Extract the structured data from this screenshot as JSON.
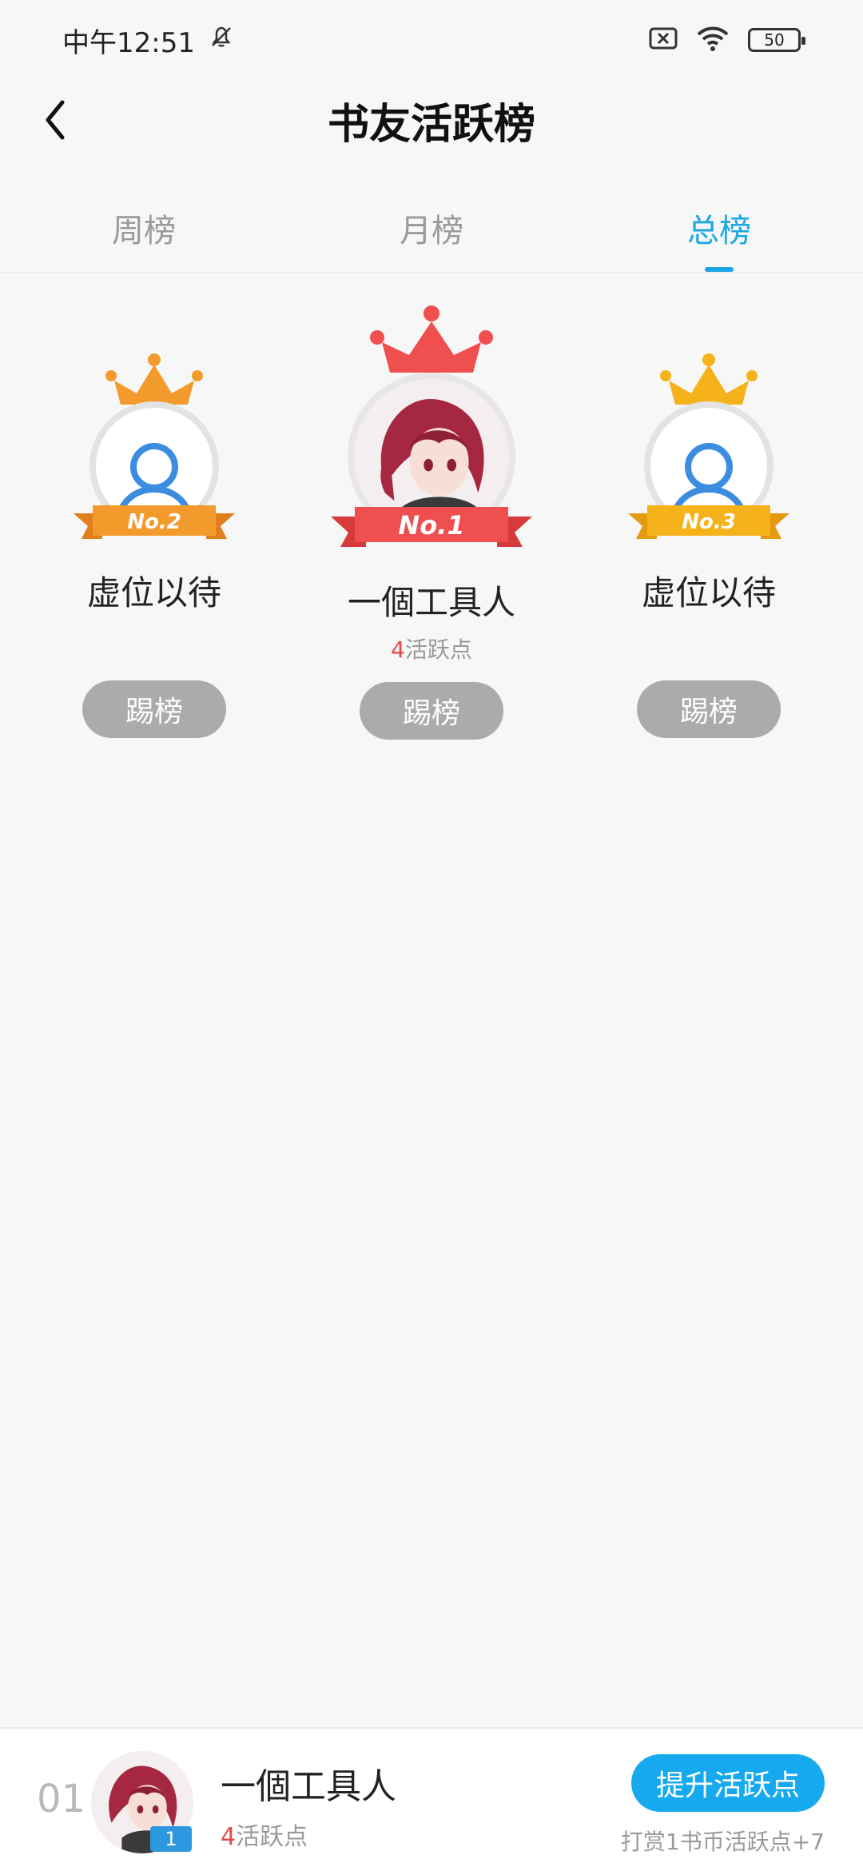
{
  "status_bar": {
    "time": "中午12:51",
    "battery": "50",
    "icons": [
      "mute-bell-icon",
      "sim-off-icon",
      "wifi-icon",
      "battery-icon"
    ]
  },
  "header": {
    "title": "书友活跃榜",
    "back_icon": "back-chevron-icon"
  },
  "tabs": [
    {
      "label": "周榜",
      "active": false
    },
    {
      "label": "月榜",
      "active": false
    },
    {
      "label": "总榜",
      "active": true
    }
  ],
  "podium": {
    "second": {
      "badge": "No.2",
      "name": "虚位以待",
      "button": "踢榜"
    },
    "first": {
      "badge": "No.1",
      "name": "一個工具人",
      "points": "4",
      "points_suffix": "活跃点",
      "button": "踢榜"
    },
    "third": {
      "badge": "No.3",
      "name": "虚位以待",
      "button": "踢榜"
    }
  },
  "bottom_bar": {
    "rank": "01",
    "level_badge": "1",
    "name": "一個工具人",
    "points": "4",
    "points_suffix": "活跃点",
    "promote_button": "提升活跃点",
    "tip": "打赏1书币活跃点+7"
  },
  "colors": {
    "accent": "#1aa7e4",
    "second_orange": "#f39a2d",
    "first_red": "#f04f4f",
    "third_yellow": "#f6b21a",
    "points_red": "#e34a4a",
    "kick_gray": "#ababab"
  }
}
